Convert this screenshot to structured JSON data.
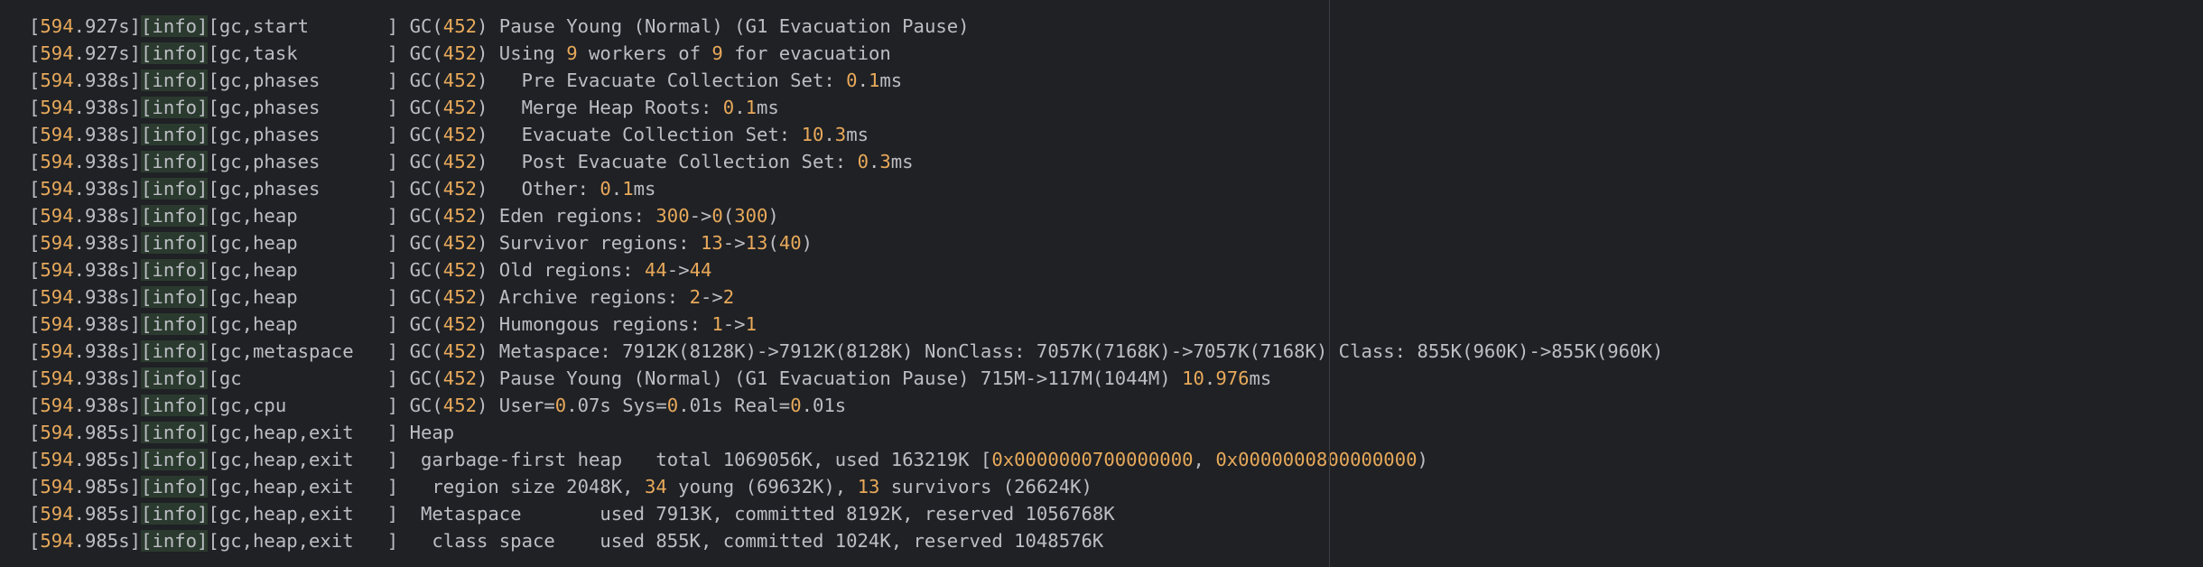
{
  "colors": {
    "background": "#1f2125",
    "text": "#bcbec4",
    "number": "#e8a95a",
    "info_highlight": "#2b3a2e",
    "right_margin_guide": "#3b3e44"
  },
  "log_lines": [
    [
      {
        "t": "["
      },
      {
        "t": "594",
        "c": "n"
      },
      {
        "t": ".927s]"
      },
      {
        "t": "[info]",
        "c": "h"
      },
      {
        "t": "[gc,start       ] GC("
      },
      {
        "t": "452",
        "c": "n"
      },
      {
        "t": ") Pause Young (Normal) (G1 Evacuation Pause)"
      }
    ],
    [
      {
        "t": "["
      },
      {
        "t": "594",
        "c": "n"
      },
      {
        "t": ".927s]"
      },
      {
        "t": "[info]",
        "c": "h"
      },
      {
        "t": "[gc,task        ] GC("
      },
      {
        "t": "452",
        "c": "n"
      },
      {
        "t": ") Using "
      },
      {
        "t": "9",
        "c": "n"
      },
      {
        "t": " workers of "
      },
      {
        "t": "9",
        "c": "n"
      },
      {
        "t": " for evacuation"
      }
    ],
    [
      {
        "t": "["
      },
      {
        "t": "594",
        "c": "n"
      },
      {
        "t": ".938s]"
      },
      {
        "t": "[info]",
        "c": "h"
      },
      {
        "t": "[gc,phases      ] GC("
      },
      {
        "t": "452",
        "c": "n"
      },
      {
        "t": ")   Pre Evacuate Collection Set: "
      },
      {
        "t": "0",
        "c": "n"
      },
      {
        "t": "."
      },
      {
        "t": "1",
        "c": "n"
      },
      {
        "t": "ms"
      }
    ],
    [
      {
        "t": "["
      },
      {
        "t": "594",
        "c": "n"
      },
      {
        "t": ".938s]"
      },
      {
        "t": "[info]",
        "c": "h"
      },
      {
        "t": "[gc,phases      ] GC("
      },
      {
        "t": "452",
        "c": "n"
      },
      {
        "t": ")   Merge Heap Roots: "
      },
      {
        "t": "0",
        "c": "n"
      },
      {
        "t": "."
      },
      {
        "t": "1",
        "c": "n"
      },
      {
        "t": "ms"
      }
    ],
    [
      {
        "t": "["
      },
      {
        "t": "594",
        "c": "n"
      },
      {
        "t": ".938s]"
      },
      {
        "t": "[info]",
        "c": "h"
      },
      {
        "t": "[gc,phases      ] GC("
      },
      {
        "t": "452",
        "c": "n"
      },
      {
        "t": ")   Evacuate Collection Set: "
      },
      {
        "t": "10",
        "c": "n"
      },
      {
        "t": "."
      },
      {
        "t": "3",
        "c": "n"
      },
      {
        "t": "ms"
      }
    ],
    [
      {
        "t": "["
      },
      {
        "t": "594",
        "c": "n"
      },
      {
        "t": ".938s]"
      },
      {
        "t": "[info]",
        "c": "h"
      },
      {
        "t": "[gc,phases      ] GC("
      },
      {
        "t": "452",
        "c": "n"
      },
      {
        "t": ")   Post Evacuate Collection Set: "
      },
      {
        "t": "0",
        "c": "n"
      },
      {
        "t": "."
      },
      {
        "t": "3",
        "c": "n"
      },
      {
        "t": "ms"
      }
    ],
    [
      {
        "t": "["
      },
      {
        "t": "594",
        "c": "n"
      },
      {
        "t": ".938s]"
      },
      {
        "t": "[info]",
        "c": "h"
      },
      {
        "t": "[gc,phases      ] GC("
      },
      {
        "t": "452",
        "c": "n"
      },
      {
        "t": ")   Other: "
      },
      {
        "t": "0",
        "c": "n"
      },
      {
        "t": "."
      },
      {
        "t": "1",
        "c": "n"
      },
      {
        "t": "ms"
      }
    ],
    [
      {
        "t": "["
      },
      {
        "t": "594",
        "c": "n"
      },
      {
        "t": ".938s]"
      },
      {
        "t": "[info]",
        "c": "h"
      },
      {
        "t": "[gc,heap        ] GC("
      },
      {
        "t": "452",
        "c": "n"
      },
      {
        "t": ") Eden regions: "
      },
      {
        "t": "300",
        "c": "n"
      },
      {
        "t": "->"
      },
      {
        "t": "0",
        "c": "n"
      },
      {
        "t": "("
      },
      {
        "t": "300",
        "c": "n"
      },
      {
        "t": ")"
      }
    ],
    [
      {
        "t": "["
      },
      {
        "t": "594",
        "c": "n"
      },
      {
        "t": ".938s]"
      },
      {
        "t": "[info]",
        "c": "h"
      },
      {
        "t": "[gc,heap        ] GC("
      },
      {
        "t": "452",
        "c": "n"
      },
      {
        "t": ") Survivor regions: "
      },
      {
        "t": "13",
        "c": "n"
      },
      {
        "t": "->"
      },
      {
        "t": "13",
        "c": "n"
      },
      {
        "t": "("
      },
      {
        "t": "40",
        "c": "n"
      },
      {
        "t": ")"
      }
    ],
    [
      {
        "t": "["
      },
      {
        "t": "594",
        "c": "n"
      },
      {
        "t": ".938s]"
      },
      {
        "t": "[info]",
        "c": "h"
      },
      {
        "t": "[gc,heap        ] GC("
      },
      {
        "t": "452",
        "c": "n"
      },
      {
        "t": ") Old regions: "
      },
      {
        "t": "44",
        "c": "n"
      },
      {
        "t": "->"
      },
      {
        "t": "44",
        "c": "n"
      }
    ],
    [
      {
        "t": "["
      },
      {
        "t": "594",
        "c": "n"
      },
      {
        "t": ".938s]"
      },
      {
        "t": "[info]",
        "c": "h"
      },
      {
        "t": "[gc,heap        ] GC("
      },
      {
        "t": "452",
        "c": "n"
      },
      {
        "t": ") Archive regions: "
      },
      {
        "t": "2",
        "c": "n"
      },
      {
        "t": "->"
      },
      {
        "t": "2",
        "c": "n"
      }
    ],
    [
      {
        "t": "["
      },
      {
        "t": "594",
        "c": "n"
      },
      {
        "t": ".938s]"
      },
      {
        "t": "[info]",
        "c": "h"
      },
      {
        "t": "[gc,heap        ] GC("
      },
      {
        "t": "452",
        "c": "n"
      },
      {
        "t": ") Humongous regions: "
      },
      {
        "t": "1",
        "c": "n"
      },
      {
        "t": "->"
      },
      {
        "t": "1",
        "c": "n"
      }
    ],
    [
      {
        "t": "["
      },
      {
        "t": "594",
        "c": "n"
      },
      {
        "t": ".938s]"
      },
      {
        "t": "[info]",
        "c": "h"
      },
      {
        "t": "[gc,metaspace   ] GC("
      },
      {
        "t": "452",
        "c": "n"
      },
      {
        "t": ") Metaspace: 7912K(8128K)->7912K(8128K) NonClass: 7057K(7168K)->7057K(7168K) Class: 855K(960K)->855K(960K)"
      }
    ],
    [
      {
        "t": "["
      },
      {
        "t": "594",
        "c": "n"
      },
      {
        "t": ".938s]"
      },
      {
        "t": "[info]",
        "c": "h"
      },
      {
        "t": "[gc             ] GC("
      },
      {
        "t": "452",
        "c": "n"
      },
      {
        "t": ") Pause Young (Normal) (G1 Evacuation Pause) 715M->117M(1044M) "
      },
      {
        "t": "10",
        "c": "n"
      },
      {
        "t": "."
      },
      {
        "t": "976",
        "c": "n"
      },
      {
        "t": "ms"
      }
    ],
    [
      {
        "t": "["
      },
      {
        "t": "594",
        "c": "n"
      },
      {
        "t": ".938s]"
      },
      {
        "t": "[info]",
        "c": "h"
      },
      {
        "t": "[gc,cpu         ] GC("
      },
      {
        "t": "452",
        "c": "n"
      },
      {
        "t": ") User="
      },
      {
        "t": "0",
        "c": "n"
      },
      {
        "t": ".07s Sys="
      },
      {
        "t": "0",
        "c": "n"
      },
      {
        "t": ".01s Real="
      },
      {
        "t": "0",
        "c": "n"
      },
      {
        "t": ".01s"
      }
    ],
    [
      {
        "t": "["
      },
      {
        "t": "594",
        "c": "n"
      },
      {
        "t": ".985s]"
      },
      {
        "t": "[info]",
        "c": "h"
      },
      {
        "t": "[gc,heap,exit   ] Heap"
      }
    ],
    [
      {
        "t": "["
      },
      {
        "t": "594",
        "c": "n"
      },
      {
        "t": ".985s]"
      },
      {
        "t": "[info]",
        "c": "h"
      },
      {
        "t": "[gc,heap,exit   ]  garbage-first heap   total 1069056K, used 163219K ["
      },
      {
        "t": "0x0000000700000000",
        "c": "n"
      },
      {
        "t": ", "
      },
      {
        "t": "0x0000000800000000",
        "c": "n"
      },
      {
        "t": ")"
      }
    ],
    [
      {
        "t": "["
      },
      {
        "t": "594",
        "c": "n"
      },
      {
        "t": ".985s]"
      },
      {
        "t": "[info]",
        "c": "h"
      },
      {
        "t": "[gc,heap,exit   ]   region size 2048K, "
      },
      {
        "t": "34",
        "c": "n"
      },
      {
        "t": " young (69632K), "
      },
      {
        "t": "13",
        "c": "n"
      },
      {
        "t": " survivors (26624K)"
      }
    ],
    [
      {
        "t": "["
      },
      {
        "t": "594",
        "c": "n"
      },
      {
        "t": ".985s]"
      },
      {
        "t": "[info]",
        "c": "h"
      },
      {
        "t": "[gc,heap,exit   ]  Metaspace       used 7913K, committed 8192K, reserved 1056768K"
      }
    ],
    [
      {
        "t": "["
      },
      {
        "t": "594",
        "c": "n"
      },
      {
        "t": ".985s]"
      },
      {
        "t": "[info]",
        "c": "h"
      },
      {
        "t": "[gc,heap,exit   ]   class space    used 855K, committed 1024K, reserved 1048576K"
      }
    ]
  ]
}
